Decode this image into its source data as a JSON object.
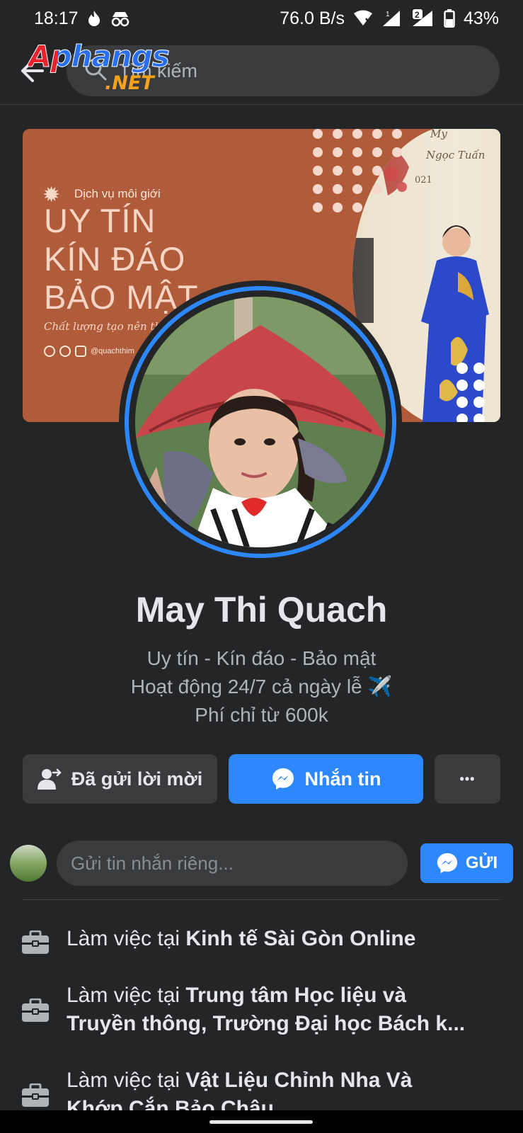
{
  "status_bar": {
    "time": "18:17",
    "net_speed": "76.0 B/s",
    "sim1": "1",
    "sim2": "2",
    "battery": "43%"
  },
  "search": {
    "placeholder": "Tìm kiếm"
  },
  "watermark": {
    "top": "Aphangs",
    "bottom": ".NET"
  },
  "cover": {
    "small_text": "Dịch vụ môi giới",
    "line1": "UY TÍN",
    "line2": "KÍN ĐÁO",
    "line3": "BẢO MẬT",
    "script": "Chất lượng tạo nên thươ",
    "handle": "@quachthim",
    "sign1": "My",
    "sign2": "Ngọc Tuấn",
    "sign3": "021"
  },
  "profile": {
    "name": "May Thi Quach",
    "bio1": "Uy tín - Kín đáo - Bảo mật",
    "bio2": "Hoạt động 24/7 cả ngày lễ ",
    "bio2_emoji": "✈️",
    "bio3": "Phí chỉ từ 600k"
  },
  "actions": {
    "sent": "Đã gửi lời mời",
    "message": "Nhắn tin",
    "more": "•••"
  },
  "message_row": {
    "placeholder": "Gửi tin nhắn riêng...",
    "send": "GỬI"
  },
  "work": [
    {
      "prefix": "Làm việc tại ",
      "place": "Kinh tế Sài Gòn Online"
    },
    {
      "prefix": "Làm việc tại ",
      "place": "Trung tâm Học liệu và",
      "place_cont": "Truyền thông, Trường Đại học Bách k..."
    },
    {
      "prefix": "Làm việc tại ",
      "place": "Vật Liệu Chỉnh Nha Và",
      "place_cont": "Khớp Cắn Bảo Châu"
    }
  ],
  "colors": {
    "background": "#242526",
    "accent": "#2d88ff",
    "cover": "#b05c3b",
    "secondary_button": "#3a3b3c"
  }
}
